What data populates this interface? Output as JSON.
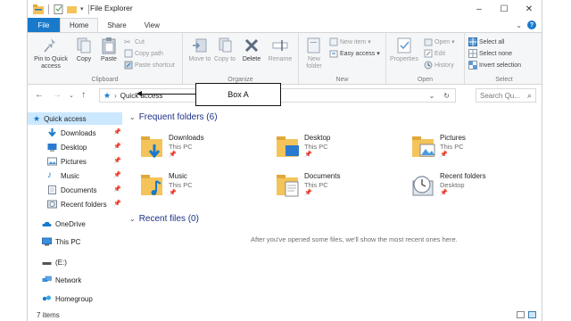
{
  "window": {
    "title": "File Explorer"
  },
  "window_controls": {
    "minimize": "–",
    "maximize": "☐",
    "close": "✕"
  },
  "ribbon_tabs": {
    "file": "File",
    "home": "Home",
    "share": "Share",
    "view": "View"
  },
  "ribbon": {
    "clipboard": {
      "label": "Clipboard",
      "pin_to_quick_access": "Pin to Quick access",
      "copy": "Copy",
      "paste": "Paste",
      "cut": "Cut",
      "copy_path": "Copy path",
      "paste_shortcut": "Paste shortcut"
    },
    "organize": {
      "label": "Organize",
      "move_to": "Move to",
      "copy_to": "Copy to",
      "delete": "Delete",
      "rename": "Rename"
    },
    "new": {
      "label": "New",
      "new_folder": "New folder",
      "new_item": "New item",
      "easy_access": "Easy access"
    },
    "open": {
      "label": "Open",
      "properties": "Properties",
      "open": "Open",
      "edit": "Edit",
      "history": "History"
    },
    "select": {
      "label": "Select",
      "select_all": "Select all",
      "select_none": "Select none",
      "invert_selection": "Invert selection"
    }
  },
  "address_bar": {
    "location": "Quick access",
    "separator": "›"
  },
  "search": {
    "placeholder": "Search Qu..."
  },
  "annotation": {
    "label": "Box A"
  },
  "nav_pane": {
    "quick_access": "Quick access",
    "items": [
      {
        "label": "Downloads",
        "pinned": true
      },
      {
        "label": "Desktop",
        "pinned": true
      },
      {
        "label": "Pictures",
        "pinned": true
      },
      {
        "label": "Music",
        "pinned": true
      },
      {
        "label": "Documents",
        "pinned": true
      },
      {
        "label": "Recent folders",
        "pinned": true
      }
    ],
    "onedrive": "OneDrive",
    "this_pc": "This PC",
    "drive_e": "(E:)",
    "network": "Network",
    "homegroup": "Homegroup"
  },
  "frequent_folders": {
    "heading": "Frequent folders (6)",
    "items": [
      {
        "name": "Downloads",
        "location": "This PC"
      },
      {
        "name": "Desktop",
        "location": "This PC"
      },
      {
        "name": "Pictures",
        "location": "This PC"
      },
      {
        "name": "Music",
        "location": "This PC"
      },
      {
        "name": "Documents",
        "location": "This PC"
      },
      {
        "name": "Recent folders",
        "location": "Desktop"
      }
    ]
  },
  "recent_files": {
    "heading": "Recent files (0)",
    "empty_message": "After you've opened some files, we'll show the most recent ones here."
  },
  "status_bar": {
    "item_count": "7 items"
  },
  "colors": {
    "accent": "#1979ca",
    "selection": "#cce8ff",
    "heading": "#1e3287",
    "folder": "#f4c45a"
  }
}
